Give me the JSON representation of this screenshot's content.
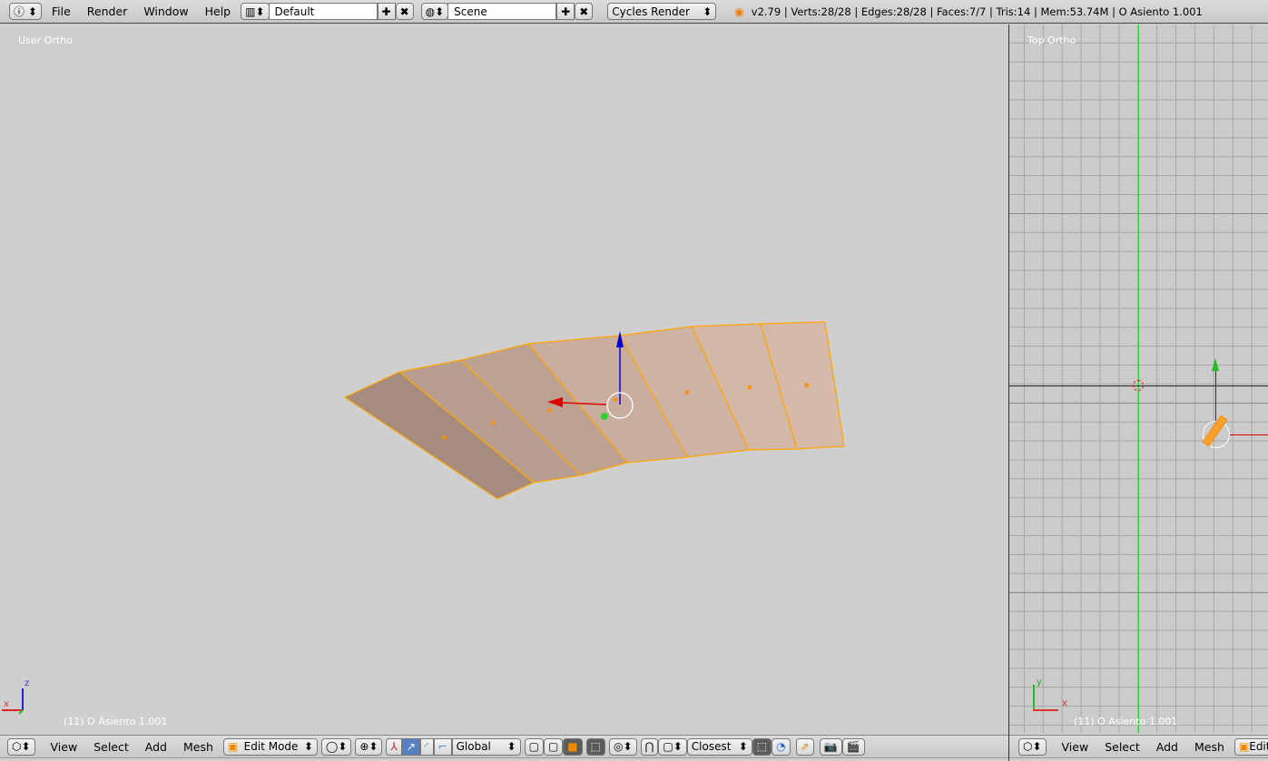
{
  "topbar": {
    "menus": [
      "File",
      "Render",
      "Window",
      "Help"
    ],
    "layout": "Default",
    "scene": "Scene",
    "engine": "Cycles Render",
    "stats": "v2.79 | Verts:28/28 | Edges:28/28 | Faces:7/7 | Tris:14 | Mem:53.74M | O Asiento 1.001",
    "icons": [
      "info-icon",
      "screen-layout-icon",
      "add-icon",
      "close-icon",
      "scene-icon",
      "blender-logo-icon"
    ]
  },
  "viewport_left": {
    "label": "User Ortho",
    "object_label": "(11) O Asiento 1.001",
    "axis_x": "x",
    "axis_z": "z"
  },
  "viewport_right": {
    "label": "Top Ortho",
    "object_label": "(11) O Asiento 1.001",
    "axis_x": "x",
    "axis_y": "y"
  },
  "header_left": {
    "menus": [
      "View",
      "Select",
      "Add",
      "Mesh"
    ],
    "mode": "Edit Mode",
    "orientation": "Global",
    "snap": "Closest"
  },
  "header_right": {
    "menus": [
      "View",
      "Select",
      "Add",
      "Mesh"
    ],
    "mode": "Edit"
  },
  "colors": {
    "selection": "#ffa500",
    "mesh_dark": "#a68c7e",
    "mesh_light": "#d6b9a9",
    "x_axis": "#dd0000",
    "y_axis": "#22cc22",
    "z_axis": "#0000dd"
  }
}
